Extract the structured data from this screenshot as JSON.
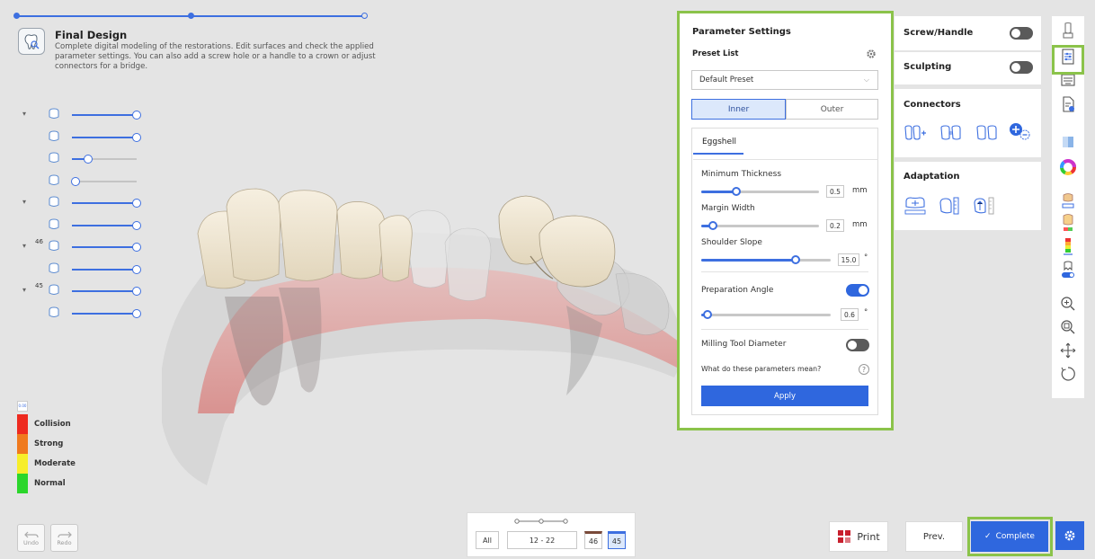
{
  "header": {
    "title": "Final Design",
    "description": "Complete digital modeling of the restorations. Edit surfaces and check the applied parameter settings. You can also add a screw hole or a handle to a crown or adjust connectors for a bridge."
  },
  "tooth_rows": [
    {
      "label": "",
      "value": 1.0
    },
    {
      "label": "",
      "value": 1.0
    },
    {
      "label": "",
      "value": 0.2
    },
    {
      "label": "",
      "value": 0.0
    },
    {
      "label": "",
      "value": 1.0
    },
    {
      "label": "",
      "value": 1.0
    },
    {
      "label": "46",
      "value": 1.0
    },
    {
      "label": "",
      "value": 1.0
    },
    {
      "label": "45",
      "value": 1.0
    },
    {
      "label": "",
      "value": 1.0
    }
  ],
  "legend": {
    "top_label": "0.00",
    "items": [
      {
        "label": "Collision",
        "color": "#ee2a1f"
      },
      {
        "label": "Strong",
        "color": "#f07a1e"
      },
      {
        "label": "Moderate",
        "color": "#f7ee2a"
      },
      {
        "label": "Normal",
        "color": "#2bd62b"
      }
    ]
  },
  "bottom_left": {
    "undo": "Undo",
    "redo": "Redo"
  },
  "tooth_range": {
    "all": "All",
    "range": "12 - 22",
    "tooth_a": "46",
    "tooth_b": "45"
  },
  "buttons": {
    "print": "Print",
    "prev": "Prev.",
    "complete": "Complete"
  },
  "parameter_settings": {
    "title": "Parameter Settings",
    "preset_list_label": "Preset List",
    "preset_selected": "Default Preset",
    "tab_inner": "Inner",
    "tab_outer": "Outer",
    "subtab": "Eggshell",
    "min_thickness": {
      "label": "Minimum Thickness",
      "value": "0.5",
      "unit": "mm",
      "level": 0.3
    },
    "margin_width": {
      "label": "Margin Width",
      "value": "0.2",
      "unit": "mm",
      "level": 0.1
    },
    "shoulder_slope": {
      "label": "Shoulder Slope",
      "value": "15.0",
      "unit": "°",
      "level": 0.73
    },
    "preparation_angle": {
      "label": "Preparation Angle",
      "enabled": true,
      "value": "0.6",
      "unit": "°",
      "level": 0.05
    },
    "milling_tool": {
      "label": "Milling Tool Diameter",
      "enabled": false
    },
    "help_text": "What do these parameters mean?",
    "help_icon": "?",
    "apply": "Apply"
  },
  "right_panel": {
    "screw_handle": {
      "label": "Screw/Handle",
      "enabled": false
    },
    "sculpting": {
      "label": "Sculpting",
      "enabled": false
    },
    "connectors": {
      "label": "Connectors"
    },
    "adaptation": {
      "label": "Adaptation"
    }
  },
  "colors": {
    "accent": "#2f67de",
    "highlight": "#8bc34a"
  }
}
